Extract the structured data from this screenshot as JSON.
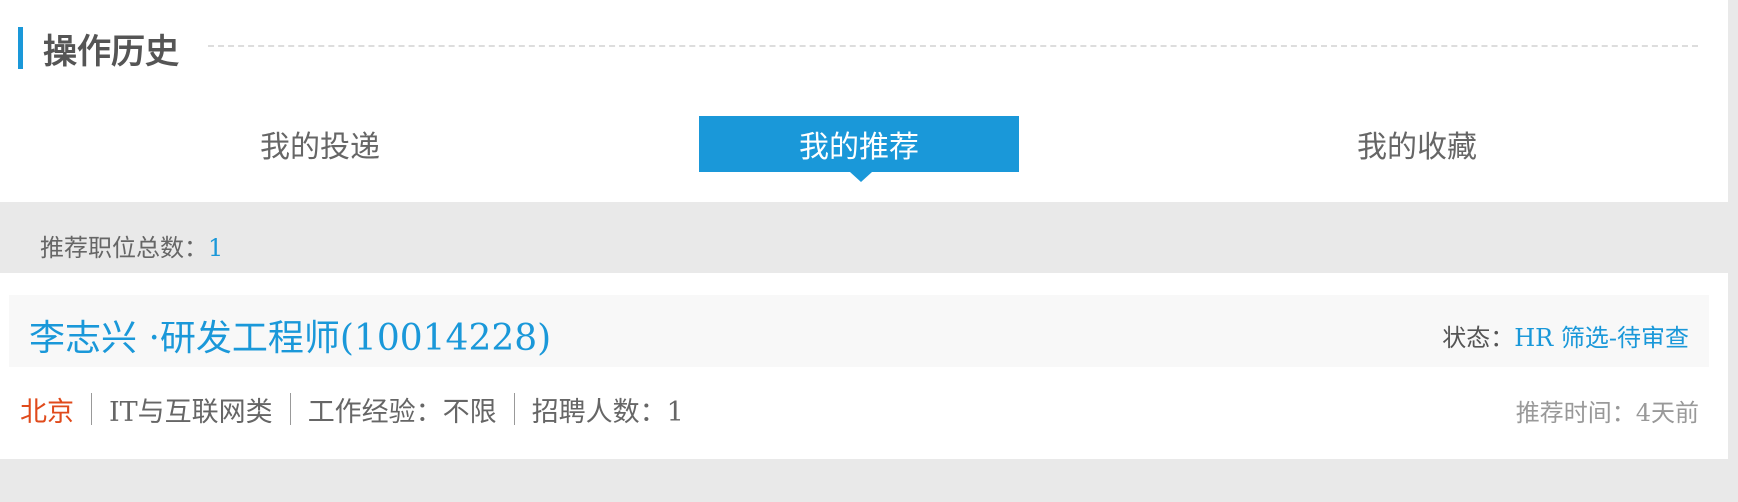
{
  "section": {
    "title": "操作历史"
  },
  "tabs": [
    {
      "label": "我的投递",
      "active": false
    },
    {
      "label": "我的推荐",
      "active": true
    },
    {
      "label": "我的收藏",
      "active": false
    }
  ],
  "summary": {
    "label": "推荐职位总数：",
    "count": "1"
  },
  "job": {
    "title": "李志兴 ·研发工程师(10014228)",
    "status_label": "状态：",
    "status_value": "HR 筛选-待审查",
    "city": "北京",
    "industry": "IT与互联网类",
    "experience": "工作经验：不限",
    "headcount": "招聘人数：1",
    "recommend_time": "推荐时间：4天前"
  },
  "colors": {
    "accent": "#1a98d9",
    "city": "#e04a1b",
    "background": "#e9e9e9"
  }
}
